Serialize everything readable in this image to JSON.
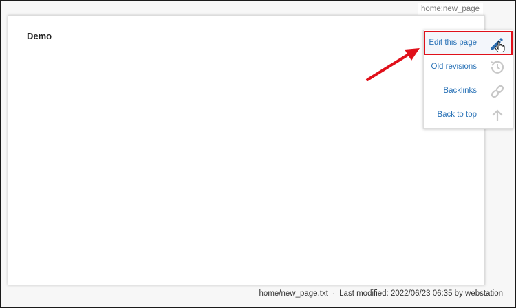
{
  "page": {
    "id": "home:new_page",
    "title": "Demo"
  },
  "page_tools": {
    "items": [
      {
        "label": "Edit this page",
        "icon": "pencil-icon",
        "highlighted": true
      },
      {
        "label": "Old revisions",
        "icon": "history-icon"
      },
      {
        "label": "Backlinks",
        "icon": "link-icon"
      },
      {
        "label": "Back to top",
        "icon": "arrow-up-icon"
      }
    ]
  },
  "footer": {
    "file": "home/new_page.txt",
    "separator": "·",
    "last_modified": "Last modified: 2022/06/23 06:35 by webstation"
  },
  "colors": {
    "link": "#2b73b7",
    "highlight_border": "#e0101a",
    "annotation_arrow": "#e0101a"
  }
}
